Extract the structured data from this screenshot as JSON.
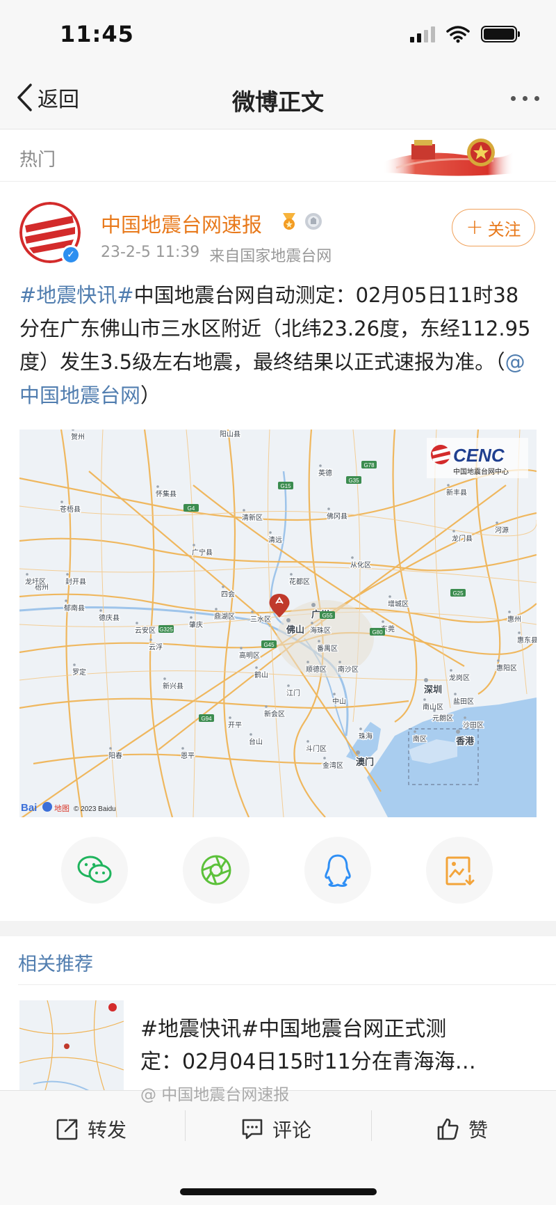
{
  "status_bar": {
    "time": "11:45"
  },
  "nav": {
    "back_label": "返回",
    "title": "微博正文"
  },
  "banner": {
    "label": "热门"
  },
  "post": {
    "author": "中国地震台网速报",
    "date": "23-2-5 11:39",
    "source": "来自国家地震台网",
    "follow_label": "关注",
    "text": {
      "hashtag": "#地震快讯#",
      "body": "中国地震台网自动测定：02月05日11时38分在广东佛山市三水区附近（北纬23.26度，东经112.95度）发生3.5级左右地震，最终结果以正式速报为准。（",
      "mention": "@中国地震台网",
      "close": "）"
    }
  },
  "map": {
    "logo_text": "CENC",
    "logo_sub": "中国地震台网中心",
    "copyright": "© 2023 Baidu",
    "baidu_label": "Bai",
    "baidu_suffix": "地图",
    "places": [
      "贺州",
      "阳山县",
      "英德",
      "新丰县",
      "苍梧县",
      "怀集县",
      "清新区",
      "佛冈县",
      "龙门县",
      "河源",
      "广宁县",
      "清远",
      "梧州",
      "龙圩区",
      "封开县",
      "从化区",
      "四会",
      "花都区",
      "增城区",
      "郁南县",
      "德庆县",
      "鼎湖区",
      "三水区",
      "广州",
      "云安区",
      "肇庆",
      "佛山",
      "海珠区",
      "东莞",
      "惠州",
      "云浮",
      "高明区",
      "番禺区",
      "惠阳区",
      "罗定",
      "顺德区",
      "南沙区",
      "龙岗区",
      "新兴县",
      "鹤山",
      "深圳",
      "江门",
      "中山",
      "盐田区",
      "新会区",
      "南山区",
      "开平",
      "元朗区",
      "沙田区",
      "阳春",
      "恩平",
      "台山",
      "珠海",
      "南区",
      "香港",
      "斗门区",
      "澳门",
      "金湾区",
      "惠东县"
    ],
    "roads": [
      "G15",
      "G78",
      "G4",
      "G55",
      "G45",
      "G25",
      "G80",
      "G94",
      "G35",
      "G325"
    ]
  },
  "share": {
    "icons": [
      "wechat-icon",
      "moments-icon",
      "qq-icon",
      "save-image-icon"
    ]
  },
  "related": {
    "title": "相关推荐",
    "item": {
      "line1": "#地震快讯#中国地震台网正式测",
      "line2": "定：02月04日15时11分在青海海…",
      "source": "@ 中国地震台网速报"
    }
  },
  "actions": {
    "repost": "转发",
    "comment": "评论",
    "like": "赞"
  },
  "colors": {
    "accent_orange": "#e8791b",
    "link_blue": "#507daf",
    "verified_blue": "#2d8ff0",
    "map_road": "#f0b456",
    "map_water": "#a9cdef",
    "marker": "#c0392b"
  }
}
